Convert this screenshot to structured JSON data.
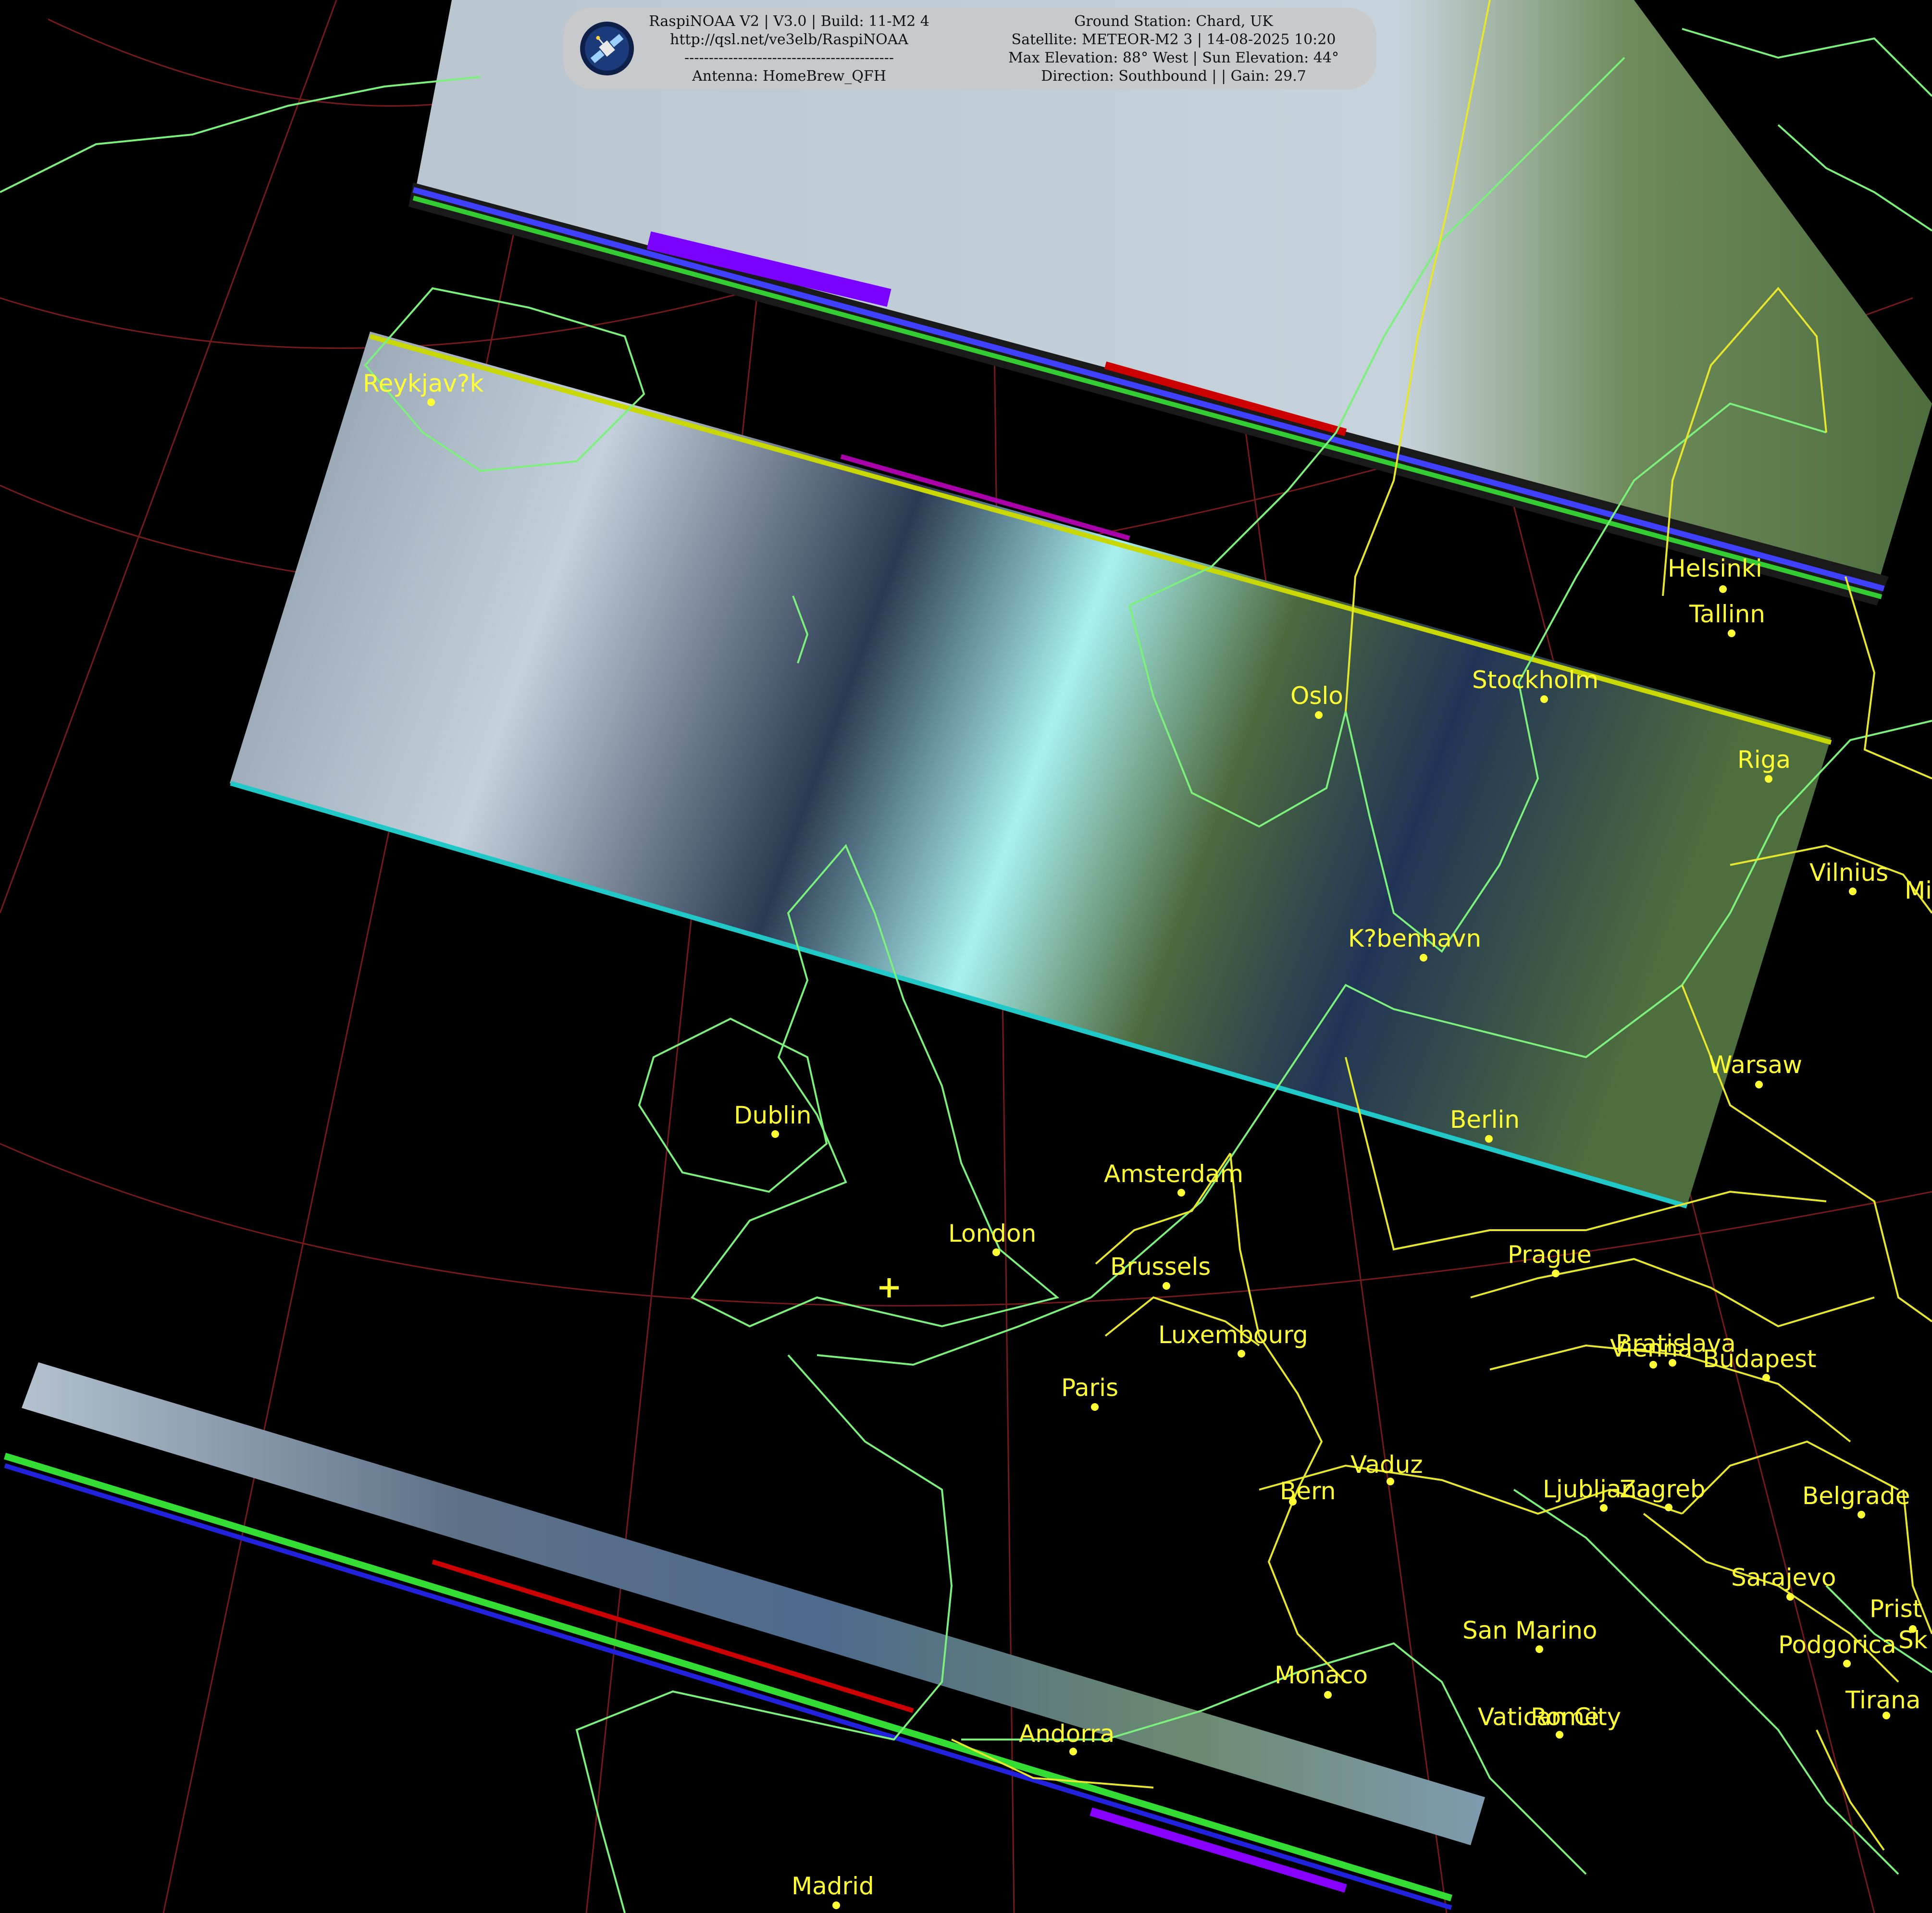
{
  "header": {
    "left_lines": [
      "RaspiNOAA V2 | V3.0 | Build: 11-M2 4",
      "http://qsl.net/ve3elb/RaspiNOAA",
      "-------------------------------------------",
      "Antenna: HomeBrew_QFH"
    ],
    "right_lines": [
      "Ground Station: Chard, UK",
      "Satellite: METEOR-M2 3 | 14-08-2025 10:20",
      "Max Elevation: 88° West | Sun Elevation: 44°",
      "Direction: Southbound | | Gain: 29.7"
    ],
    "logo_icon": "satellite-icon"
  },
  "cities": [
    {
      "name": "Reykjav?k"
    },
    {
      "name": "Helsinki"
    },
    {
      "name": "Tallinn"
    },
    {
      "name": "Stockholm"
    },
    {
      "name": "Oslo"
    },
    {
      "name": "Riga"
    },
    {
      "name": "Vilnius"
    },
    {
      "name": "Mi"
    },
    {
      "name": "K?benhavn"
    },
    {
      "name": "Warsaw"
    },
    {
      "name": "Dublin"
    },
    {
      "name": "Berlin"
    },
    {
      "name": "Amsterdam"
    },
    {
      "name": "London"
    },
    {
      "name": "Prague"
    },
    {
      "name": "Brussels"
    },
    {
      "name": "Luxembourg"
    },
    {
      "name": "Bratislava"
    },
    {
      "name": "Vienna"
    },
    {
      "name": "Budapest"
    },
    {
      "name": "Paris"
    },
    {
      "name": "Vaduz"
    },
    {
      "name": "Bern"
    },
    {
      "name": "Ljubljana"
    },
    {
      "name": "Zagreb"
    },
    {
      "name": "Belgrade"
    },
    {
      "name": "Sarajevo"
    },
    {
      "name": "Prist"
    },
    {
      "name": "Sk"
    },
    {
      "name": "Podgorica"
    },
    {
      "name": "San Marino"
    },
    {
      "name": "Monaco"
    },
    {
      "name": "Tirana"
    },
    {
      "name": "Vatican City"
    },
    {
      "name": "Rome"
    },
    {
      "name": "Andorra"
    },
    {
      "name": "Madrid"
    }
  ],
  "colors": {
    "background": "#000000",
    "coastline": "#7cf07c",
    "border": "#e6e62e",
    "graticule": "#8a1f1f",
    "city": "#ffff33"
  }
}
